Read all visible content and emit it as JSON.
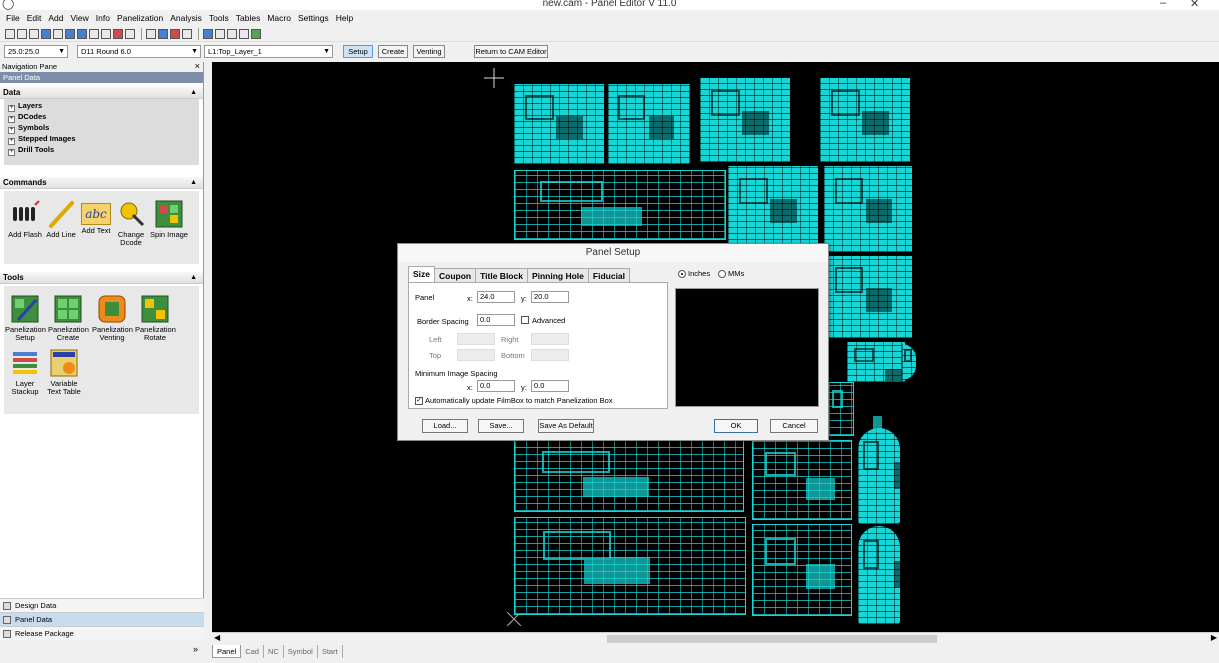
{
  "window": {
    "title": "new.cam - Panel Editor  V 11.0",
    "minimize": "–",
    "close": "✕"
  },
  "menu": [
    "File",
    "Edit",
    "Add",
    "View",
    "Info",
    "Panelization",
    "Analysis",
    "Tools",
    "Tables",
    "Macro",
    "Settings",
    "Help"
  ],
  "toolbar2": {
    "zoom_combo": "25.0:25.0",
    "dcode_combo": "D11   Round 6.0",
    "layer_combo": "L1:Top_Layer_1",
    "setup_btn": "Setup",
    "create_btn": "Create",
    "venting_btn": "Venting",
    "return_btn": "Return to CAM Editor"
  },
  "nav": {
    "title": "Navigation Pane",
    "close": "×",
    "subtitle": "Panel Data",
    "data_section": "Data",
    "data_items": [
      "Layers",
      "DCodes",
      "Symbols",
      "Stepped Images",
      "Drill Tools"
    ],
    "commands_section": "Commands",
    "commands": [
      {
        "l1": "Add Flash",
        "l2": ""
      },
      {
        "l1": "Add Line",
        "l2": ""
      },
      {
        "l1": "Add Text",
        "l2": ""
      },
      {
        "l1": "Change",
        "l2": "Dcode"
      },
      {
        "l1": "Spin Image",
        "l2": ""
      }
    ],
    "add_text_icon_label": "abc",
    "tools_section": "Tools",
    "tools": [
      {
        "l1": "Panelization",
        "l2": "Setup"
      },
      {
        "l1": "Panelization",
        "l2": "Create"
      },
      {
        "l1": "Panelization",
        "l2": "Venting"
      },
      {
        "l1": "Panelization",
        "l2": "Rotate"
      },
      {
        "l1": "Layer",
        "l2": "Stackup"
      },
      {
        "l1": "Variable",
        "l2": "Text Table"
      }
    ],
    "bottom_buttons": [
      "Design Data",
      "Panel Data",
      "Release Package"
    ],
    "active_bottom": 1,
    "chevron": "»"
  },
  "bottom_tabs": [
    "Panel",
    "Cad",
    "NC",
    "Symbol",
    "Start"
  ],
  "dialog": {
    "title": "Panel Setup",
    "tabs": [
      "Size",
      "Coupon",
      "Title Block",
      "Pinning Hole",
      "Fiducial"
    ],
    "units": {
      "inches": "Inches",
      "mms": "MMs",
      "selected": "inches"
    },
    "panel_label": "Panel",
    "x_label": "x:",
    "y_label": "y:",
    "panel_x": "24.0",
    "panel_y": "20.0",
    "border_spacing_label": "Border Spacing",
    "border_spacing": "0.0",
    "advanced_label": "Advanced",
    "left_label": "Left",
    "right_label": "Right",
    "top_label": "Top",
    "bottom_label": "Bottom",
    "min_spacing_label": "Minimum Image Spacing",
    "min_x": "0.0",
    "min_y": "0.0",
    "auto_update_label": "Automatically update FilmBox to match Panelization Box",
    "auto_update_checked": true,
    "check_mark": "✓",
    "buttons": {
      "load": "Load...",
      "save": "Save...",
      "save_default": "Save As Default",
      "ok": "OK",
      "cancel": "Cancel"
    }
  },
  "colors": {
    "pcb": "#18d6d6",
    "canvas": "#000000",
    "nav_header": "#7d8fa8"
  }
}
